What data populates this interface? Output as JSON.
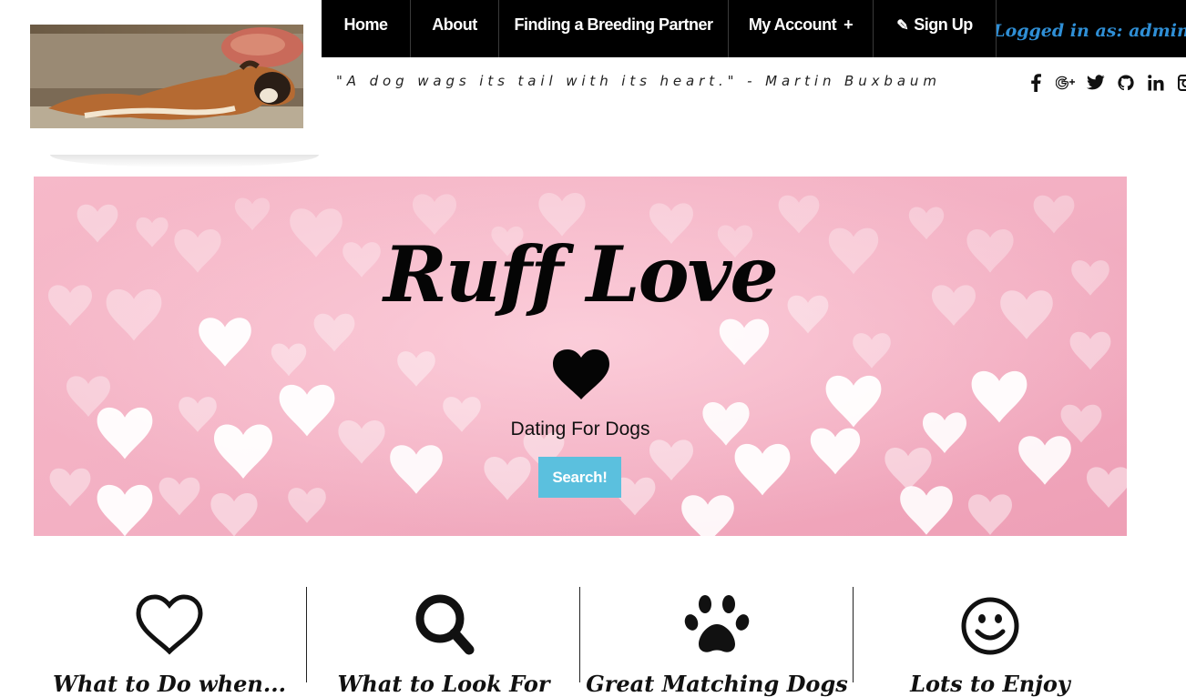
{
  "logo": {
    "alt": "Boxer dog lounging on a couch"
  },
  "nav": {
    "items": [
      {
        "label": "Home"
      },
      {
        "label": "About"
      },
      {
        "label": "Finding a Breeding Partner"
      },
      {
        "label": "My Account",
        "suffix": "+"
      },
      {
        "label": "Sign Up",
        "icon": "pencil-icon"
      }
    ],
    "logged_in": "Logged in as: admin"
  },
  "quote": "\"A dog wags its tail with its heart.\" - Martin Buxbaum",
  "social": [
    "facebook-icon",
    "google-plus-icon",
    "twitter-icon",
    "github-icon",
    "linkedin-icon",
    "instagram-icon"
  ],
  "hero": {
    "title": "Ruff Love",
    "subtitle": "Dating For Dogs",
    "button": "Search!"
  },
  "features": [
    {
      "icon": "heart-outline-icon",
      "label": "What to Do when..."
    },
    {
      "icon": "search-icon",
      "label": "What to Look For"
    },
    {
      "icon": "paw-icon",
      "label": "Great Matching Dogs"
    },
    {
      "icon": "smiley-icon",
      "label": "Lots to Enjoy"
    }
  ],
  "colors": {
    "nav_bg": "#000000",
    "accent_blue": "#2f8fd6",
    "button": "#5bc0de",
    "hero_pink": "#f2a9bd"
  }
}
